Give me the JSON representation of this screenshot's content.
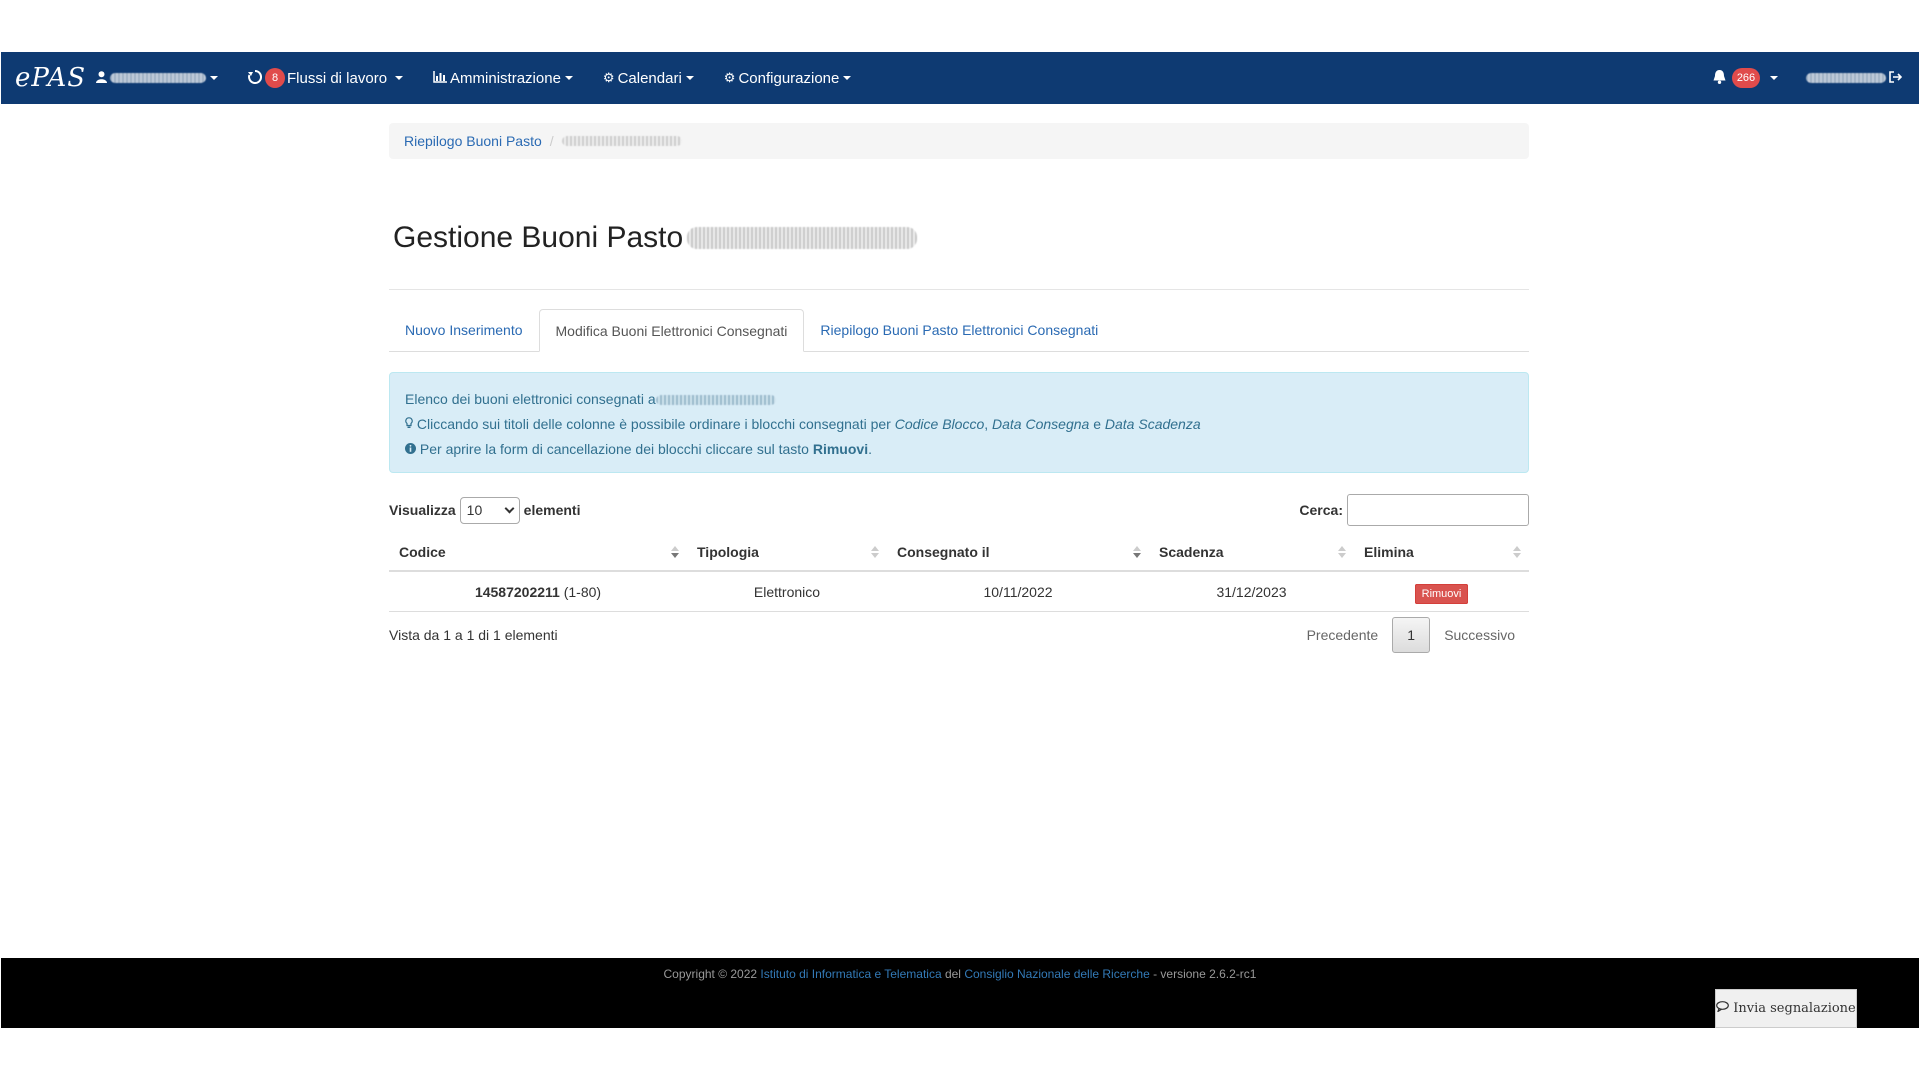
{
  "navbar": {
    "brand": "ePAS",
    "workflows": {
      "label": "Flussi di lavoro",
      "badge": "8"
    },
    "admin_label": "Amministrazione",
    "calendars_label": "Calendari",
    "config_label": "Configurazione",
    "notifications_badge": "266",
    "icons": {
      "user": "user-icon",
      "workflows": "recycle-icon",
      "admin": "bar-chart-icon",
      "calendars": "gear-icon",
      "config": "gear-icon",
      "bell": "bell-icon",
      "logout": "logout-icon"
    },
    "bg_color": "#0e3a72"
  },
  "breadcrumb": {
    "link": "Riepilogo Buoni Pasto",
    "separator": "/"
  },
  "page": {
    "title": "Gestione Buoni Pasto"
  },
  "tabs": [
    {
      "label": "Nuovo Inserimento",
      "active": false
    },
    {
      "label": "Modifica Buoni Elettronici Consegnati",
      "active": true
    },
    {
      "label": "Riepilogo Buoni Pasto Elettronici Consegnati",
      "active": false
    }
  ],
  "alert": {
    "line1": "Elenco dei buoni elettronici consegnati a",
    "line2_prefix": "Cliccando sui titoli delle colonne è possibile ordinare i blocchi consegnati per ",
    "line2_col1": "Codice Blocco",
    "line2_sep1": ", ",
    "line2_col2": "Data Consegna",
    "line2_sep2": " e ",
    "line2_col3": "Data Scadenza",
    "line3_prefix": "Per aprire la form di cancellazione dei blocchi cliccare sul tasto ",
    "line3_bold": "Rimuovi",
    "line3_suffix": "."
  },
  "controls": {
    "show_label": "Visualizza",
    "page_length": "10",
    "elements_label": "elementi",
    "search_label": "Cerca:",
    "search_value": ""
  },
  "table": {
    "headers": [
      "Codice",
      "Tipologia",
      "Consegnato il",
      "Scadenza",
      "Elimina"
    ],
    "rows": [
      {
        "code": "14587202211",
        "range": "(1-80)",
        "type": "Elettronico",
        "delivered": "10/11/2022",
        "expiry": "31/12/2023",
        "action": "Rimuovi"
      }
    ]
  },
  "pagination": {
    "info": "Vista da 1 a 1 di 1 elementi",
    "prev": "Precedente",
    "current": "1",
    "next": "Successivo"
  },
  "footer": {
    "prefix": "Copyright © 2022 ",
    "link1": "Istituto di Informatica e Telematica",
    "middle": " del ",
    "link2": "Consiglio Nazionale delle Ricerche",
    "suffix": " - versione 2.6.2-rc1"
  },
  "report_button": "Invia segnalazione"
}
